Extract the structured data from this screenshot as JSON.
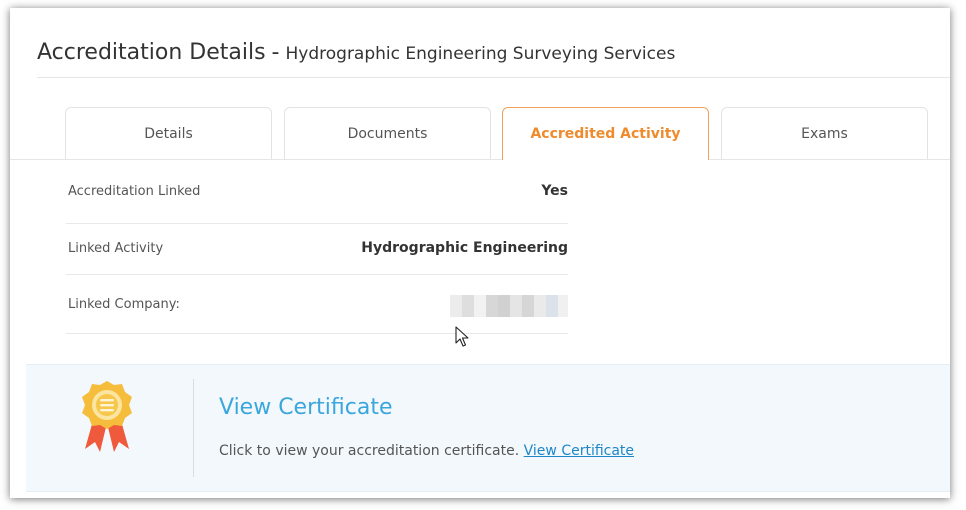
{
  "header": {
    "title": "Accreditation Details",
    "separator": "-",
    "subtitle": "Hydrographic Engineering Surveying Services"
  },
  "tabs": [
    {
      "label": "Details",
      "active": false
    },
    {
      "label": "Documents",
      "active": false
    },
    {
      "label": "Accredited Activity",
      "active": true
    },
    {
      "label": "Exams",
      "active": false
    }
  ],
  "details": {
    "rows": [
      {
        "label": "Accreditation Linked",
        "value": "Yes"
      },
      {
        "label": "Linked Activity",
        "value": "Hydrographic Engineering"
      },
      {
        "label": "Linked Company:",
        "value": ""
      }
    ]
  },
  "certificate": {
    "icon": "award-ribbon-icon",
    "title": "View Certificate",
    "description": "Click to view your accreditation certificate.",
    "link_label": "View Certificate"
  },
  "colors": {
    "accent_orange": "#ef8b2c",
    "link_blue": "#1f86c8",
    "cert_title_blue": "#3aa6dd",
    "panel_bg": "#f2f8fc"
  }
}
